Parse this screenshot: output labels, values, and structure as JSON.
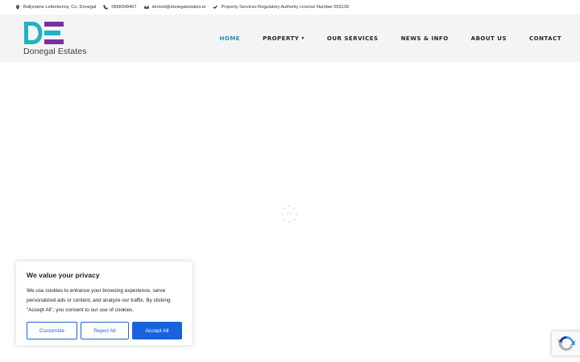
{
  "topbar": {
    "address": "Ballynaine Letterkenny, Co. Donegal",
    "phone": "0868349407",
    "email": "dermot@donegalestates.ie",
    "license": "Property Services Regulatory Authority License Number 003139"
  },
  "brand": {
    "name": "Donegal Estates",
    "colors": {
      "teal": "#1fb3c4",
      "purple": "#7b2fa0"
    }
  },
  "nav": {
    "items": [
      {
        "label": "HOME",
        "active": true
      },
      {
        "label": "PROPERTY",
        "dropdown": true
      },
      {
        "label": "OUR SERVICES"
      },
      {
        "label": "NEWS & INFO"
      },
      {
        "label": "ABOUT US"
      },
      {
        "label": "CONTACT"
      }
    ],
    "active_color": "#1f8fb0"
  },
  "cookie": {
    "title": "We value your privacy",
    "text": "We use cookies to enhance your browsing experience, serve personalized ads or content, and analyze our traffic. By clicking \"Accept All\", you consent to our use of cookies.",
    "customize_label": "Customize",
    "reject_label": "Reject All",
    "accept_label": "Accept All",
    "accent": "#1863dc"
  }
}
